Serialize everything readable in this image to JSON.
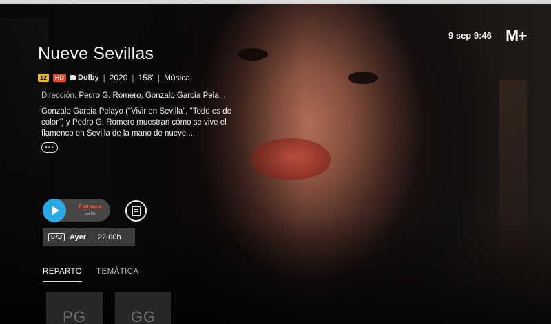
{
  "status": {
    "clock": "9 sep 9:46",
    "brand_logo": "M+"
  },
  "program": {
    "title": "Nueve Sevillas",
    "age_rating": "12",
    "quality_badge": "HD",
    "audio": "Dolby",
    "year": "2020",
    "duration": "158'",
    "genre": "Música",
    "director_label": "Dirección:",
    "director_names": "Pedro G. Romero, Gonzalo García Pela",
    "director_fade": "...",
    "synopsis": "Gonzalo García Pelayo (\"Vivir en Sevilla\", \"Todo es de color\") y Pedro G. Romero muestran cómo se vive el flamenco en Sevilla de la mano de nueve ...",
    "more_label": "•••"
  },
  "actions": {
    "channel_top": "Estrenos",
    "channel_bottom": "por M+",
    "catchup_badge": "U7D",
    "airing_day": "Ayer",
    "airing_time": "22.00h"
  },
  "tabs": [
    {
      "label": "REPARTO",
      "active": true
    },
    {
      "label": "TEMÁTICA",
      "active": false
    }
  ],
  "cast": [
    {
      "initials": "PG"
    },
    {
      "initials": "GG"
    }
  ],
  "colors": {
    "accent_play": "#29a8e6",
    "badge_age": "#f0c020",
    "badge_hd": "#e94020",
    "channel_red": "#ff5a3a"
  },
  "icons": {
    "play": "play-icon",
    "watchlist": "list-icon",
    "dolby": "dolby-icon",
    "more": "more-icon"
  }
}
